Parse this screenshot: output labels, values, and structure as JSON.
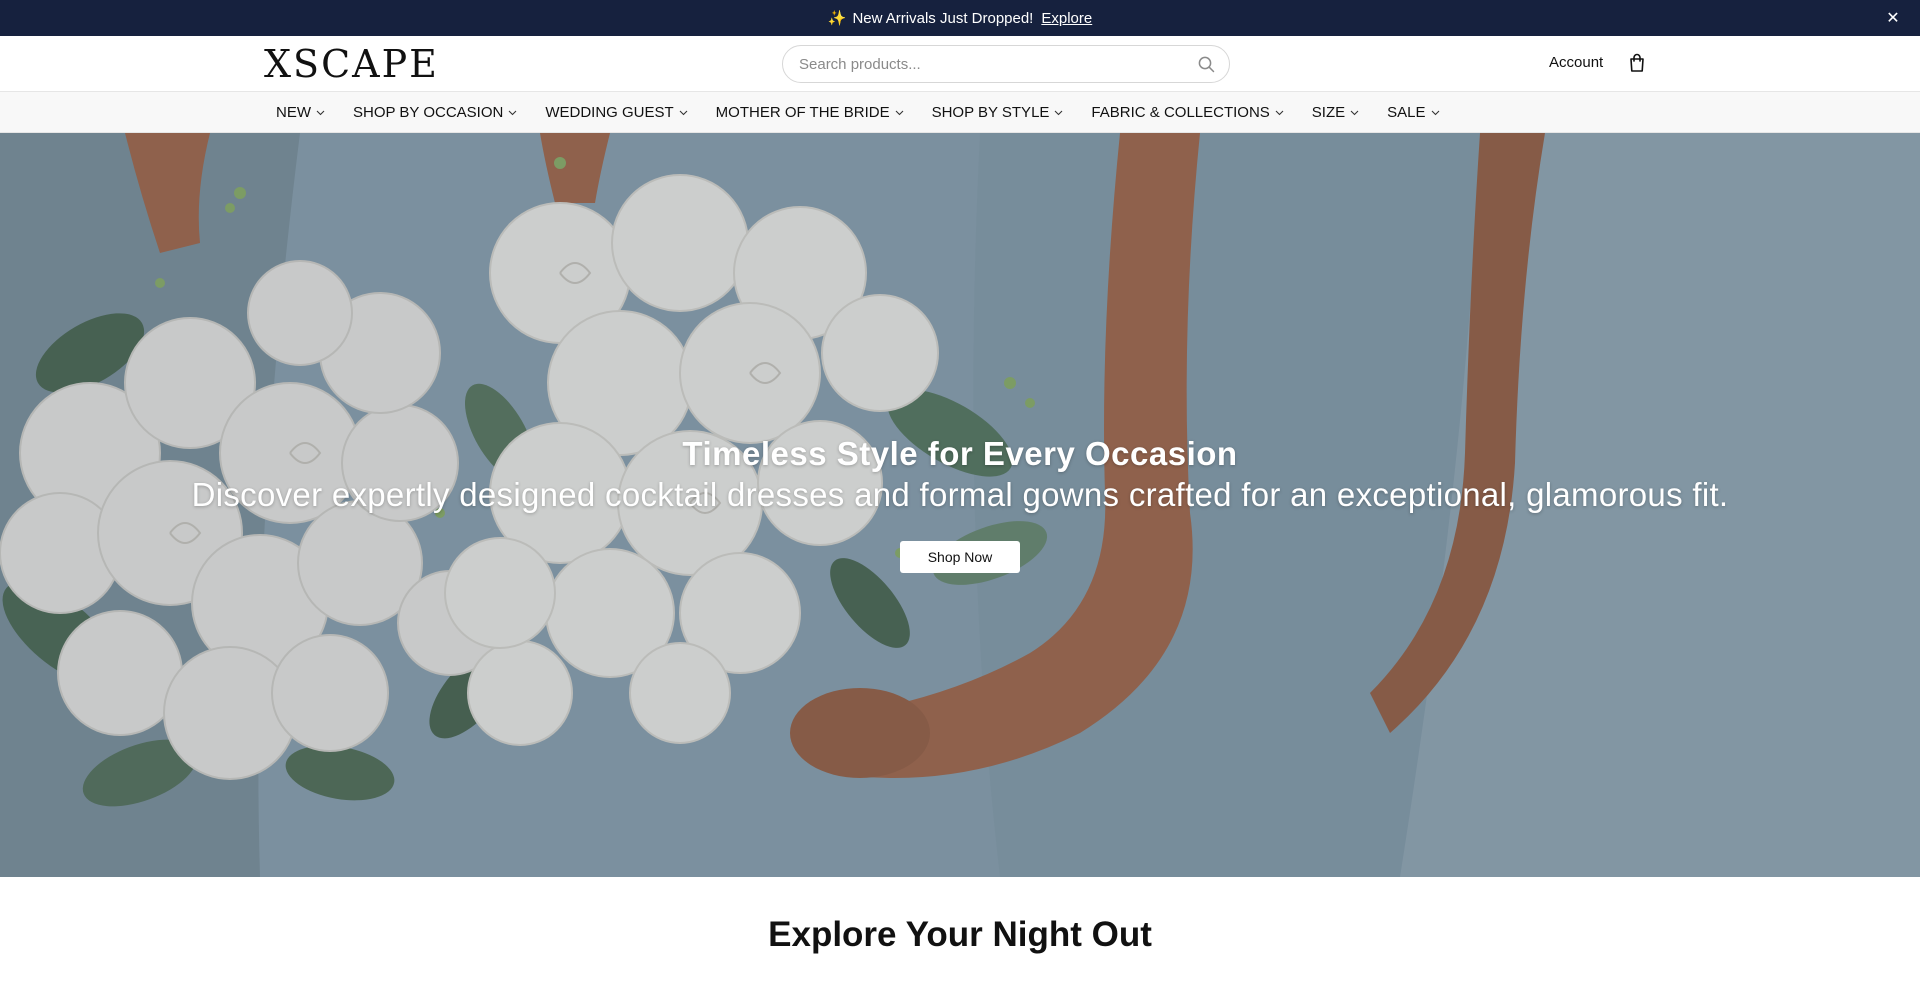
{
  "announcement": {
    "text": "New Arrivals Just Dropped!",
    "link": "Explore",
    "spark_icon": "sparkles-icon",
    "close_icon": "close-icon"
  },
  "header": {
    "logo": "XSCAPE",
    "search_placeholder": "Search products...",
    "account_label": "Account",
    "bag_icon": "shopping-bag-icon"
  },
  "nav": {
    "items": [
      {
        "label": "NEW"
      },
      {
        "label": "SHOP BY OCCASION"
      },
      {
        "label": "WEDDING GUEST"
      },
      {
        "label": "MOTHER OF THE BRIDE"
      },
      {
        "label": "SHOP BY STYLE"
      },
      {
        "label": "FABRIC & COLLECTIONS"
      },
      {
        "label": "SIZE"
      },
      {
        "label": "SALE"
      }
    ]
  },
  "hero": {
    "title": "Timeless Style for Every Occasion",
    "subtitle": "Discover expertly designed cocktail dresses and formal gowns crafted for an exceptional, glamorous fit.",
    "button_label": "Shop Now"
  },
  "section": {
    "title": "Explore Your Night Out"
  },
  "colors": {
    "announcement_bg": "#16213e",
    "nav_bg": "#f8f8f8",
    "dress": "#8fa6b4"
  }
}
